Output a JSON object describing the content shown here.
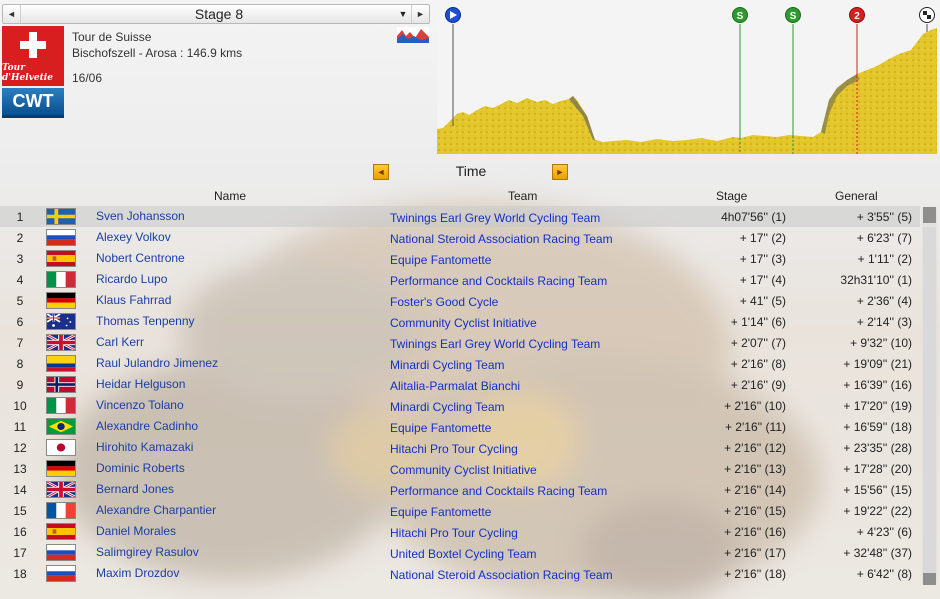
{
  "stage_selector": {
    "label": "Stage 8",
    "prev_symbol": "◄",
    "next_symbol": "►",
    "dropdown_symbol": "▼"
  },
  "race": {
    "name": "Tour de Suisse",
    "route": "Bischofszell - Arosa : 146.9 kms",
    "date": "16/06",
    "logo_text": "Tour d'Helvetie",
    "category": "CWT"
  },
  "profile_markers": [
    {
      "label": "",
      "icon": "start-flag-icon",
      "color": "#1f4fd0"
    },
    {
      "label": "S",
      "icon": "sprint-icon",
      "color": "#2f9a2f"
    },
    {
      "label": "S",
      "icon": "sprint-icon",
      "color": "#2f9a2f"
    },
    {
      "label": "2",
      "icon": "climb-cat-2-icon",
      "color": "#d81e1e"
    },
    {
      "label": "",
      "icon": "finish-flag-icon",
      "color": "#222222"
    }
  ],
  "time_nav": {
    "label": "Time",
    "prev_symbol": "◄",
    "next_symbol": "►"
  },
  "columns": {
    "name": "Name",
    "team": "Team",
    "stage": "Stage",
    "general": "General"
  },
  "rows": [
    {
      "pos": "1",
      "flag": "se",
      "name": "Sven Johansson",
      "team": "Twinings Earl Grey World Cycling Team",
      "stage": "4h07'56'' (1)",
      "general": "+ 3'55'' (5)",
      "selected": true
    },
    {
      "pos": "2",
      "flag": "ru",
      "name": "Alexey Volkov",
      "team": "National Steroid Association Racing Team",
      "stage": "+ 17'' (2)",
      "general": "+ 6'23'' (7)"
    },
    {
      "pos": "3",
      "flag": "es",
      "name": "Nobert Centrone",
      "team": "Equipe Fantomette",
      "stage": "+ 17'' (3)",
      "general": "+ 1'11'' (2)"
    },
    {
      "pos": "4",
      "flag": "it",
      "name": "Ricardo Lupo",
      "team": "Performance and Cocktails Racing Team",
      "stage": "+ 17'' (4)",
      "general": "32h31'10'' (1)"
    },
    {
      "pos": "5",
      "flag": "de",
      "name": "Klaus Fahrrad",
      "team": "Foster's Good Cycle",
      "stage": "+ 41'' (5)",
      "general": "+ 2'36'' (4)"
    },
    {
      "pos": "6",
      "flag": "au",
      "name": "Thomas Tenpenny",
      "team": "Community Cyclist Initiative",
      "stage": "+ 1'14'' (6)",
      "general": "+ 2'14'' (3)"
    },
    {
      "pos": "7",
      "flag": "gb",
      "name": "Carl Kerr",
      "team": "Twinings Earl Grey World Cycling Team",
      "stage": "+ 2'07'' (7)",
      "general": "+ 9'32'' (10)"
    },
    {
      "pos": "8",
      "flag": "co",
      "name": "Raul Julandro Jimenez",
      "team": "Minardi Cycling Team",
      "stage": "+ 2'16'' (8)",
      "general": "+ 19'09'' (21)"
    },
    {
      "pos": "9",
      "flag": "no",
      "name": "Heidar Helguson",
      "team": "Alitalia-Parmalat Bianchi",
      "stage": "+ 2'16'' (9)",
      "general": "+ 16'39'' (16)"
    },
    {
      "pos": "10",
      "flag": "it",
      "name": "Vincenzo Tolano",
      "team": "Minardi Cycling Team",
      "stage": "+ 2'16'' (10)",
      "general": "+ 17'20'' (19)"
    },
    {
      "pos": "11",
      "flag": "br",
      "name": "Alexandre Cadinho",
      "team": "Equipe Fantomette",
      "stage": "+ 2'16'' (11)",
      "general": "+ 16'59'' (18)"
    },
    {
      "pos": "12",
      "flag": "jp",
      "name": "Hirohito Kamazaki",
      "team": "Hitachi Pro Tour Cycling",
      "stage": "+ 2'16'' (12)",
      "general": "+ 23'35'' (28)"
    },
    {
      "pos": "13",
      "flag": "de",
      "name": "Dominic Roberts",
      "team": "Community Cyclist Initiative",
      "stage": "+ 2'16'' (13)",
      "general": "+ 17'28'' (20)"
    },
    {
      "pos": "14",
      "flag": "gb",
      "name": "Bernard Jones",
      "team": "Performance and Cocktails Racing Team",
      "stage": "+ 2'16'' (14)",
      "general": "+ 15'56'' (15)"
    },
    {
      "pos": "15",
      "flag": "fr",
      "name": "Alexandre Charpantier",
      "team": "Equipe Fantomette",
      "stage": "+ 2'16'' (15)",
      "general": "+ 19'22'' (22)"
    },
    {
      "pos": "16",
      "flag": "es",
      "name": "Daniel Morales",
      "team": "Hitachi Pro Tour Cycling",
      "stage": "+ 2'16'' (16)",
      "general": "+ 4'23'' (6)"
    },
    {
      "pos": "17",
      "flag": "ru",
      "name": "Salimgirey Rasulov",
      "team": "United Boxtel Cycling Team",
      "stage": "+ 2'16'' (17)",
      "general": "+ 32'48'' (37)"
    },
    {
      "pos": "18",
      "flag": "ru",
      "name": "Maxim Drozdov",
      "team": "National Steroid Association Racing Team",
      "stage": "+ 2'16'' (18)",
      "general": "+ 6'42'' (8)"
    }
  ]
}
